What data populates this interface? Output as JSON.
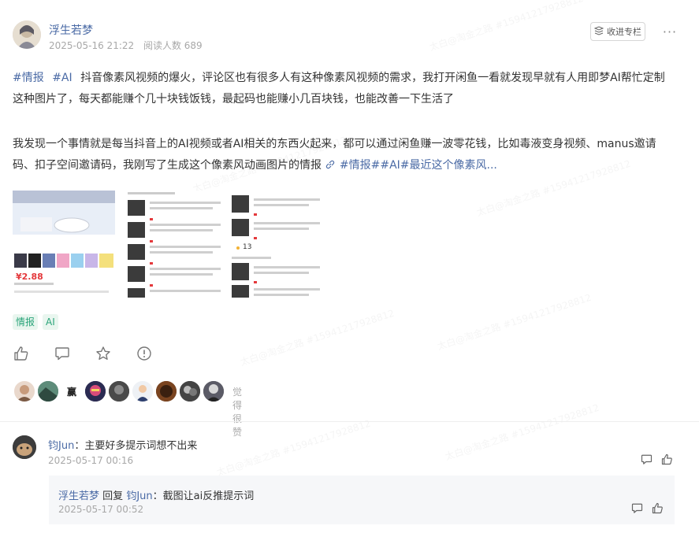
{
  "watermark": "太白@淘金之路 #15941217928812",
  "post": {
    "author": "浮生若梦",
    "date": "2025-05-16 21:22",
    "readers": "阅读人数 689",
    "collect_label": "收进专栏",
    "more_label": "···",
    "paragraph1": {
      "tag1": "#情报",
      "tag2": "#AI",
      "text": "抖音像素风视频的爆火，评论区也有很多人有这种像素风视频的需求，我打开闲鱼一看就发现早就有人用即梦AI帮忙定制这种图片了，每天都能赚个几十块钱饭钱，最起码也能赚小几百块钱，也能改善一下生活了"
    },
    "paragraph2": {
      "text": "我发现一个事情就是每当抖音上的AI视频或者AI相关的东西火起来，都可以通过闲鱼赚一波零花钱，比如毒液变身视频、manus邀请码、扣子空间邀请码，我刚写了生成这个像素风动画图片的情报",
      "link": "#情报##AI#最近这个像素风..."
    },
    "images": {
      "thumb1_price": "¥2.88",
      "thumb3_count": "13"
    },
    "tags": [
      "情报",
      "AI"
    ],
    "likers_label": "觉得很赞",
    "liker_letter": "赢"
  },
  "comments": [
    {
      "author": "钧Jun",
      "text": "：主要好多提示词想不出来",
      "time": "2025-05-17 00:16"
    }
  ],
  "reply": {
    "author": "浮生若梦",
    "reply_word": "回复",
    "target": "钧Jun",
    "text": "：截图让ai反推提示词",
    "time": "2025-05-17 00:52"
  },
  "colors": {
    "link": "#4a6aa5",
    "tag_text": "#2aa47a",
    "tag_bg": "#e9f6ef",
    "reply_bg": "#f6f7f9"
  },
  "icons": [
    "collect-icon",
    "more-icon",
    "like-icon",
    "comment-icon",
    "star-icon",
    "report-icon",
    "link-icon"
  ]
}
